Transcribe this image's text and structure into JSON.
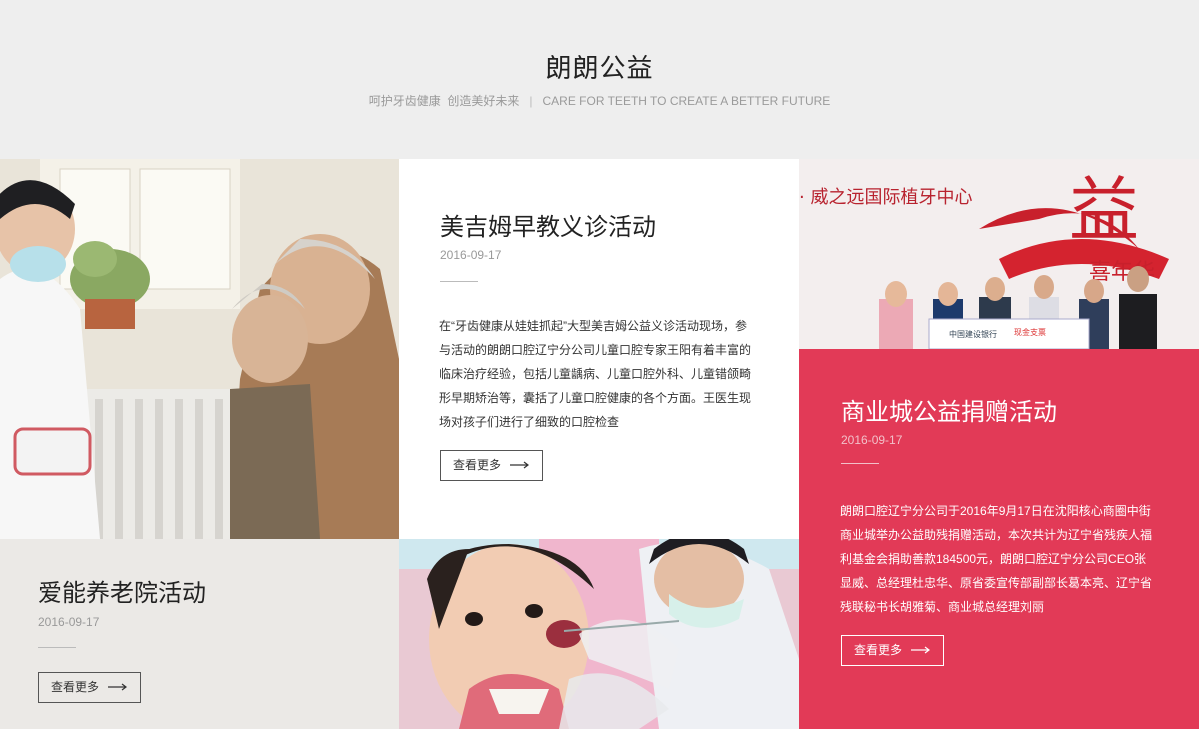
{
  "header": {
    "title": "朗朗公益",
    "subtitle_cn": "呵护牙齿健康  创造美好未来",
    "subtitle_sep": "|",
    "subtitle_en": "CARE FOR TEETH TO CREATE A BETTER FUTURE"
  },
  "cards": [
    {
      "title": "美吉姆早教义诊活动",
      "date": "2016-09-17",
      "body": "在“牙齿健康从娃娃抓起”大型美吉姆公益义诊活动现场，参与活动的朗朗口腔辽宁分公司儿童口腔专家王阳有着丰富的临床治疗经验，包括儿童龋病、儿童口腔外科、儿童错颌畸形早期矫治等，囊括了儿童口腔健康的各个方面。王医生现场对孩子们进行了细致的口腔检查",
      "more_label": "查看更多"
    },
    {
      "title": "商业城公益捐赠活动",
      "date": "2016-09-17",
      "body": "朗朗口腔辽宁分公司于2016年9月17日在沈阳核心商圈中街商业城举办公益助残捐赠活动，本次共计为辽宁省残疾人福利基金会捐助善款184500元，朗朗口腔辽宁分公司CEO张显威、总经理杜忠华、原省委宣传部副部长葛本亮、辽宁省残联秘书长胡雅菊、商业城总经理刘丽",
      "more_label": "查看更多"
    },
    {
      "title": "爱能养老院活动",
      "date": "2016-09-17",
      "more_label": "查看更多"
    }
  ],
  "photos": {
    "banner_text": "· 威之远国际植牙中心",
    "banner_art_text": "益",
    "banner_art_text2": "喜年华",
    "board_text": "中国建设银行",
    "board_text2": "现金支票"
  },
  "colors": {
    "header_bg": "#eeeeee",
    "accent_red": "#e23a57",
    "beige_bg": "#ebe9e6"
  }
}
